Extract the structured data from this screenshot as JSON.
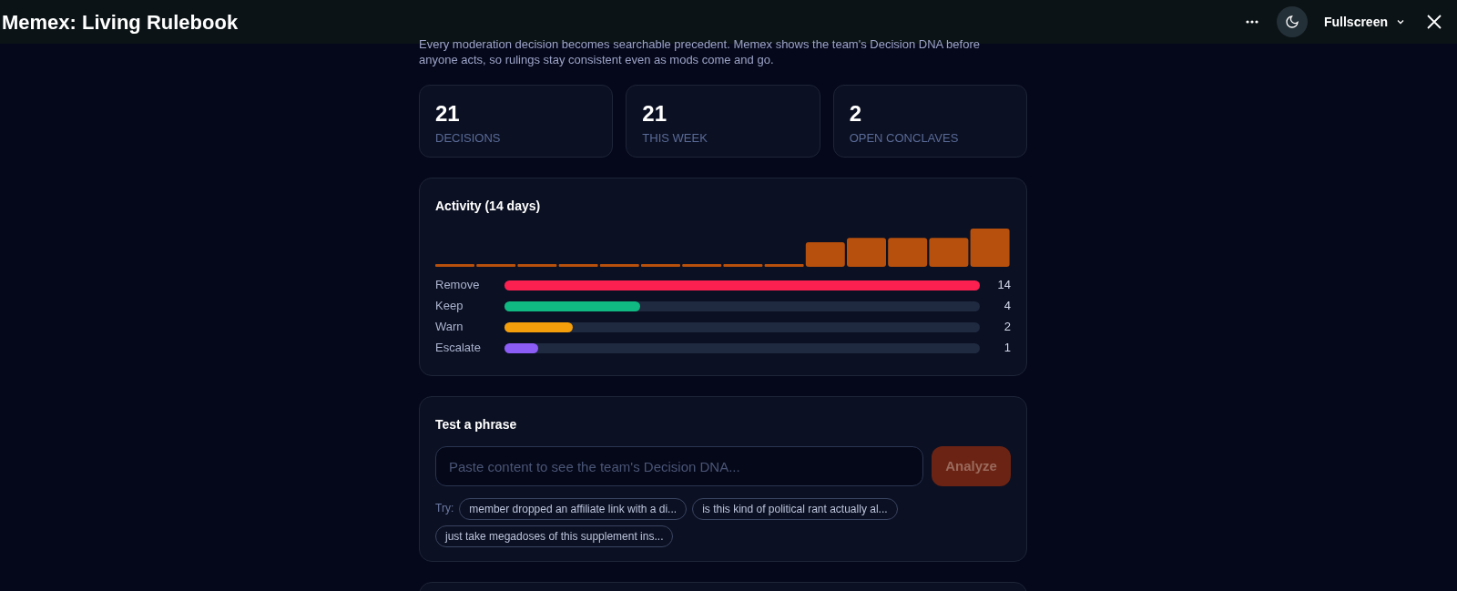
{
  "window": {
    "title": "Memex: Living Rulebook",
    "fullscreen_label": "Fullscreen"
  },
  "intro": "Every moderation decision becomes searchable precedent. Memex shows the team's Decision DNA before anyone acts, so rulings stay consistent even as mods come and go.",
  "stats": [
    {
      "value": "21",
      "label": "DECISIONS"
    },
    {
      "value": "21",
      "label": "THIS WEEK"
    },
    {
      "value": "2",
      "label": "OPEN CONCLAVES"
    }
  ],
  "activity": {
    "title": "Activity (14 days)",
    "outcomes": [
      {
        "name": "Remove",
        "level": 1,
        "count": "14",
        "color": "#fb2050"
      },
      {
        "name": "Keep",
        "level": 0.286,
        "count": "4",
        "color": "#10b981"
      },
      {
        "name": "Warn",
        "level": 0.143,
        "count": "2",
        "color": "#f59e0b"
      },
      {
        "name": "Escalate",
        "level": 0.071,
        "count": "1",
        "color": "#8b5cf6"
      }
    ]
  },
  "test": {
    "title": "Test a phrase",
    "placeholder": "Paste content to see the team's Decision DNA...",
    "button": "Analyze",
    "try_label": "Try:",
    "suggestions": [
      "member dropped an affiliate link with a di...",
      "is this kind of political rant actually al...",
      "just take megadoses of this supplement ins..."
    ]
  }
}
